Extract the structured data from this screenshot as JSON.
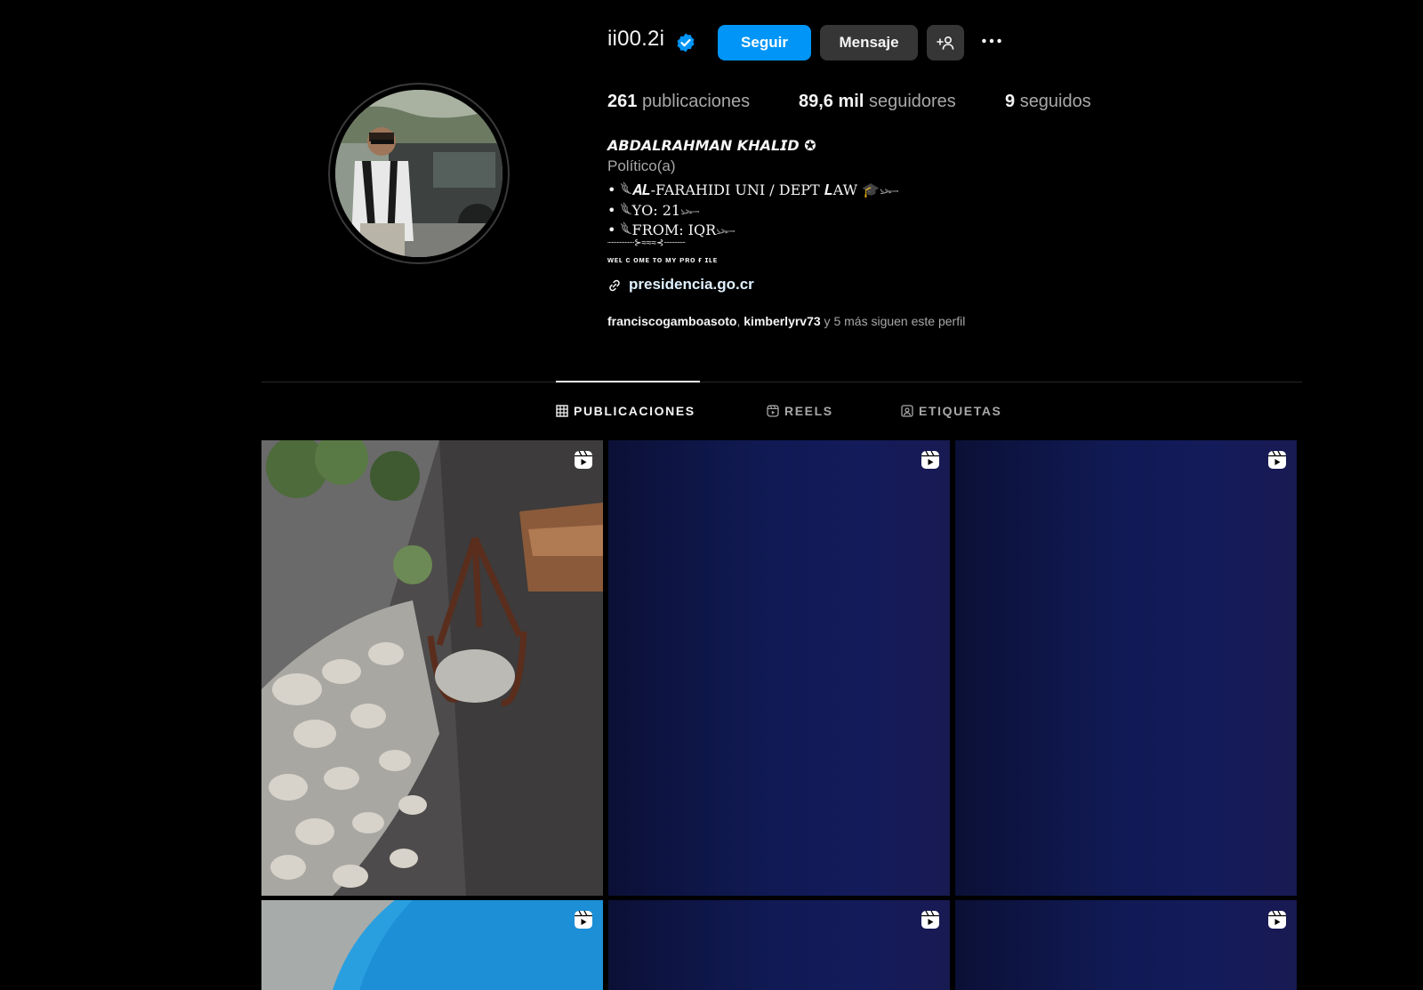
{
  "profile": {
    "username": "ii00.2i",
    "verified": true,
    "buttons": {
      "follow": "Seguir",
      "message": "Mensaje"
    },
    "stats": {
      "posts_count": "261",
      "posts_label": "publicaciones",
      "followers_count": "89,6 mil",
      "followers_label": "seguidores",
      "following_count": "9",
      "following_label": "seguidos"
    },
    "bio": {
      "name": "𝘼𝘽𝘿𝘼𝙇𝙍𝘼𝙃𝙈𝘼𝙉 𝙆𝙃𝘼𝙇𝙄𝘿 ✪",
      "category": "Político(a)",
      "lines": [
        "• 𓆰𝑨𝑳-FARAHIDI UNI / DEPT 𝑳AW 🎓𓆱",
        "• 𓆰YO: 21𓆱",
        "• 𓆰FROM: IQR𓆱"
      ],
      "ornament": "┈┈┈┈┈⊱≈≈≈⊰┈┈┈┈",
      "welcome": "ᴡᴇʟ ᴄ ᴏᴍᴇ ᴛᴏ ᴍʏ ᴘʀᴏ ғ ɪʟᴇ",
      "link": "presidencia.go.cr"
    },
    "followed_by": {
      "user1": "franciscogamboasoto",
      "separator": ", ",
      "user2": "kimberlyrv73",
      "suffix": " y 5 más siguen este perfil"
    }
  },
  "tabs": [
    {
      "label": "PUBLICACIONES",
      "active": true,
      "icon": "grid-icon"
    },
    {
      "label": "REELS",
      "active": false,
      "icon": "reels-icon"
    },
    {
      "label": "ETIQUETAS",
      "active": false,
      "icon": "tagged-icon"
    }
  ],
  "posts": [
    {
      "type": "reel",
      "thumbnail": "rocks-and-claw"
    },
    {
      "type": "reel",
      "thumbnail": "dark-blue"
    },
    {
      "type": "reel",
      "thumbnail": "dark-blue"
    },
    {
      "type": "reel",
      "thumbnail": "blue-cloth"
    },
    {
      "type": "reel",
      "thumbnail": "dark-blue"
    },
    {
      "type": "reel",
      "thumbnail": "dark-blue"
    }
  ],
  "colors": {
    "background": "#000000",
    "accent": "#0095f6",
    "secondary_button": "#363636",
    "muted_text": "#a8a8a8",
    "verified_badge": "#0095f6"
  }
}
